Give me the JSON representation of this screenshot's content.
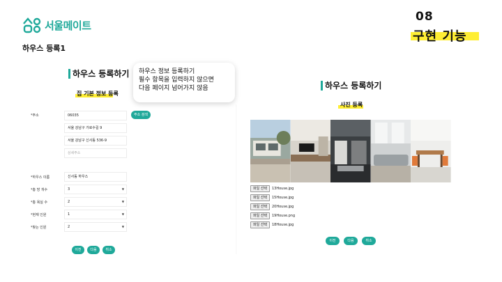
{
  "brand": {
    "name": "서울메이트",
    "accent": "#1fa99a",
    "highlight": "#ffee33"
  },
  "section": {
    "number": "08",
    "title": "구현 기능"
  },
  "page_heading": "하우스 등록1",
  "left_panel": {
    "title": "하우스 등록하기",
    "subtitle": "집 기본 정보 등록",
    "address": {
      "label": "*주소",
      "postcode": "06035",
      "road": "서울 강남구 가로수길 9",
      "jibun": "서울 강남구 신사동 536-9",
      "detail_placeholder": "상세주소",
      "search_button": "주소 검색"
    },
    "fields": [
      {
        "label": "*하우스 이름",
        "value": "신사동 하우스",
        "type": "text"
      },
      {
        "label": "*총 방 개수",
        "value": "3",
        "type": "select"
      },
      {
        "label": "*총 욕실 수",
        "value": "2",
        "type": "select"
      },
      {
        "label": "*현재 인원",
        "value": "1",
        "type": "select"
      },
      {
        "label": "*찾는 인원",
        "value": "2",
        "type": "select"
      }
    ],
    "buttons": {
      "prev": "이전",
      "next": "다음",
      "cancel": "취소"
    }
  },
  "tooltip": {
    "lines": [
      "하우스 정보 등록하기",
      "필수 항목을 입력하지 않으면",
      "다음 페이지 넘어가지 않음"
    ]
  },
  "right_panel": {
    "title": "하우스 등록하기",
    "subtitle": "사진 등록",
    "photos": [
      "exterior-photo",
      "living-room-photo",
      "kitchen-photo",
      "lounge-photo",
      "dining-photo"
    ],
    "file_button_label": "파일 선택",
    "files": [
      "13House.jpg",
      "15House.jpg",
      "20House.jpg",
      "19House.png",
      "18House.jpg"
    ],
    "buttons": {
      "prev": "이전",
      "next": "다음",
      "cancel": "취소"
    }
  }
}
